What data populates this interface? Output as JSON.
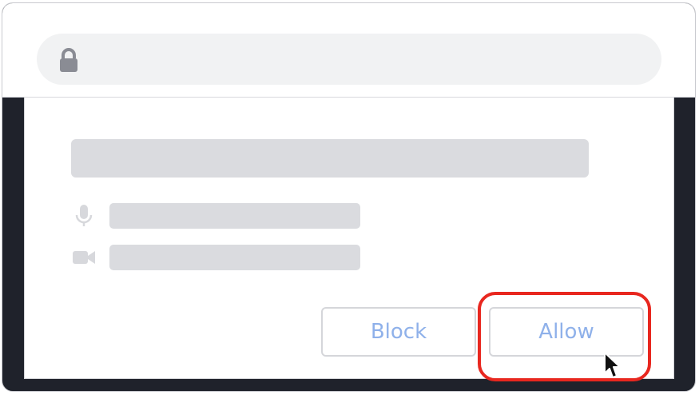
{
  "browser": {
    "lock_icon": "lock-icon",
    "url_text": ""
  },
  "permission_prompt": {
    "title_text": "",
    "permissions": [
      {
        "icon": "microphone-icon",
        "label": ""
      },
      {
        "icon": "camera-icon",
        "label": ""
      }
    ],
    "block_label": "Block",
    "allow_label": "Allow"
  },
  "colors": {
    "highlight": "#e8271f",
    "button_text": "#8fb1ea",
    "placeholder": "#dadbdf",
    "icon_gray": "#8a8c94"
  }
}
